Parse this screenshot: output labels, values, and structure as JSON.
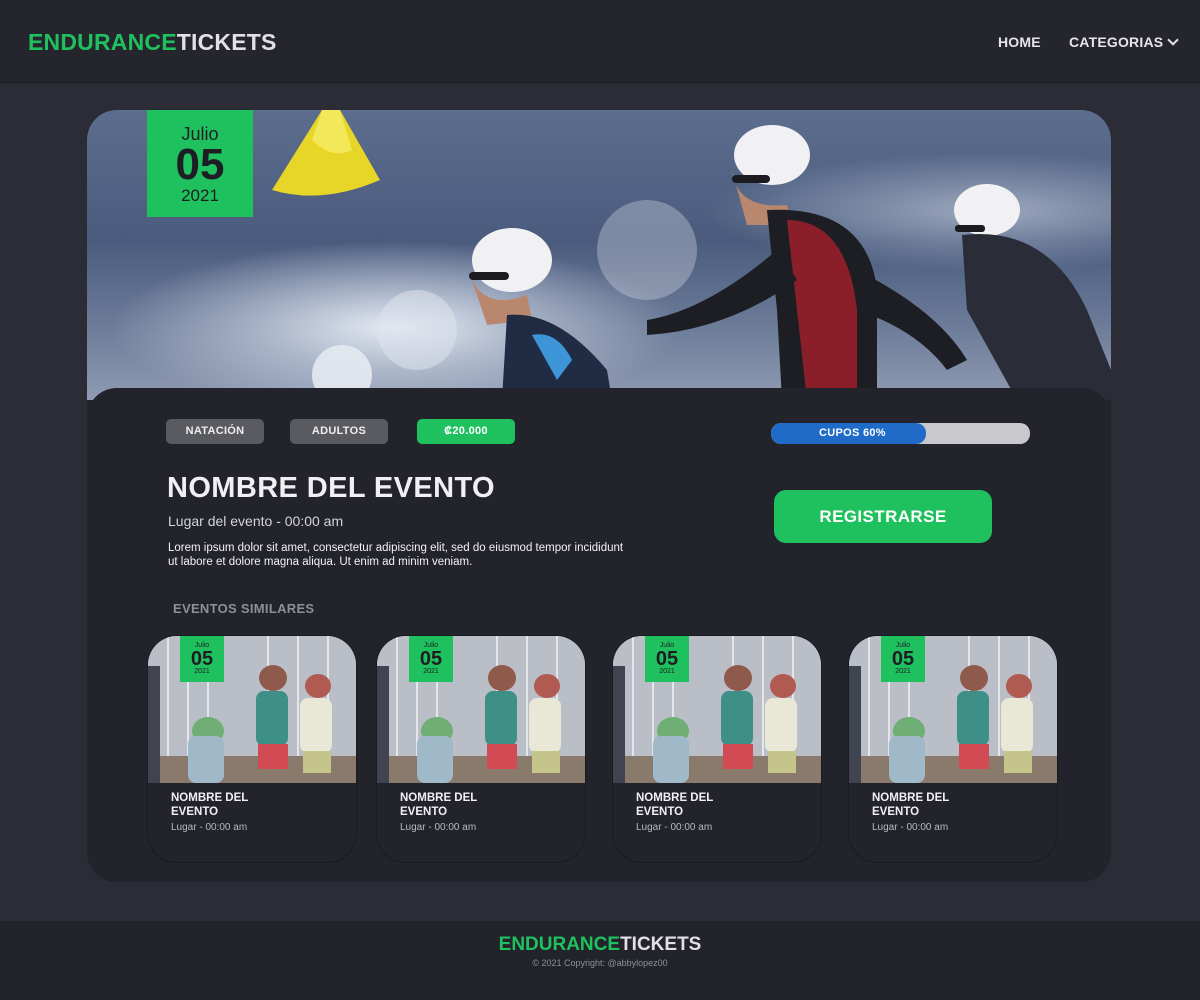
{
  "brand": {
    "part1": "ENDURANCE",
    "part2": "TICKETS"
  },
  "nav": {
    "home": "HOME",
    "categories": "CATEGORIAS"
  },
  "event": {
    "date": {
      "month": "Julio",
      "day": "05",
      "year": "2021"
    },
    "tags": [
      "NATACIÓN",
      "ADULTOS"
    ],
    "price": "₡20.000",
    "capacity": {
      "label": "CUPOS 60%",
      "percent": 60
    },
    "title": "NOMBRE DEL EVENTO",
    "place_time": "Lugar del evento - 00:00 am",
    "description": "Lorem ipsum dolor sit amet, consectetur adipiscing elit, sed do eiusmod tempor incididunt ut labore et dolore magna aliqua. Ut enim ad minim veniam.",
    "register_label": "REGISTRARSE"
  },
  "similar": {
    "title": "EVENTOS SIMILARES",
    "items": [
      {
        "month": "Julio",
        "day": "05",
        "year": "2021",
        "title": "NOMBRE DEL EVENTO",
        "place": "Lugar - 00:00 am"
      },
      {
        "month": "Julio",
        "day": "05",
        "year": "2021",
        "title": "NOMBRE DEL EVENTO",
        "place": "Lugar - 00:00 am"
      },
      {
        "month": "Julio",
        "day": "05",
        "year": "2021",
        "title": "NOMBRE DEL EVENTO",
        "place": "Lugar - 00:00 am"
      },
      {
        "month": "Julio",
        "day": "05",
        "year": "2021",
        "title": "NOMBRE DEL EVENTO",
        "place": "Lugar - 00:00 am"
      }
    ]
  },
  "footer": {
    "copyright": "© 2021 Copyright: @abbylopez00"
  },
  "colors": {
    "accent": "#1fc15f",
    "progress": "#1f6bc7",
    "background": "#2b2c35",
    "surface": "#22232b"
  },
  "icons": {
    "categories_dropdown": "chevron-down-icon"
  }
}
